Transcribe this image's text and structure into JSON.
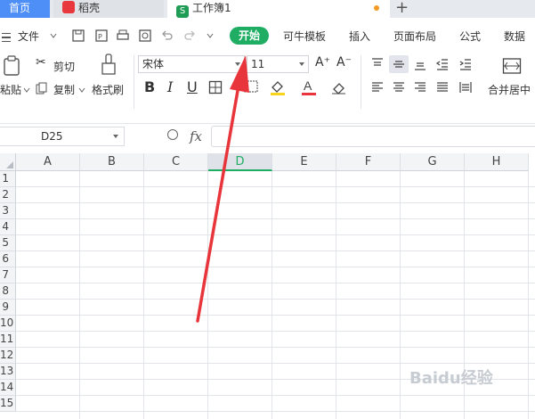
{
  "tabs": {
    "home": "首页",
    "daoke": "稻壳",
    "workbook": "工作簿1",
    "new_tab": "+"
  },
  "menu": {
    "file": "文件",
    "items": [
      "开始",
      "可牛模板",
      "插入",
      "页面布局",
      "公式",
      "数据"
    ]
  },
  "ribbon": {
    "paste": "粘贴",
    "cut": "剪切",
    "copy": "复制",
    "format_painter": "格式刷",
    "font_name": "宋体",
    "font_size": "11",
    "merge_center": "合并居中"
  },
  "formula_bar": {
    "cell_ref": "D25",
    "fx": "fx"
  },
  "grid": {
    "columns": [
      "A",
      "B",
      "C",
      "D",
      "E",
      "F",
      "G",
      "H"
    ],
    "active_column": "D",
    "rows": [
      "1",
      "2",
      "3",
      "4",
      "5",
      "6",
      "7",
      "8",
      "9",
      "10",
      "11",
      "12",
      "13",
      "14",
      "15"
    ]
  },
  "watermark": "Baidu经验",
  "colors": {
    "accent_green": "#1fad63",
    "home_tab_blue": "#4d8ef7",
    "arrow_red": "#e8353b"
  }
}
